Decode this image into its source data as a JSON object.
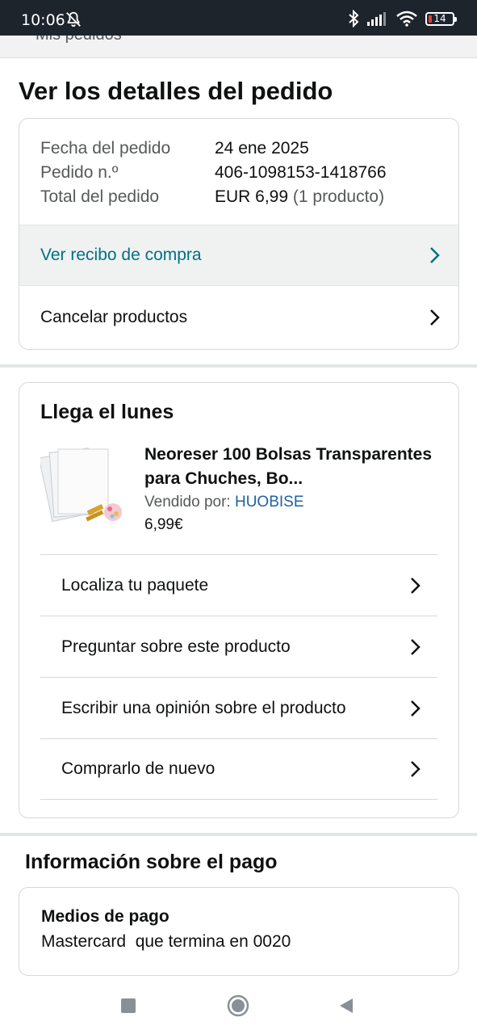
{
  "status_bar": {
    "time": "10:06",
    "battery": "14",
    "icons": [
      "mute-notification-icon",
      "bluetooth-icon",
      "signal-icon",
      "wifi-icon",
      "battery-icon"
    ]
  },
  "top_strip": {
    "text": "Mis pedidos"
  },
  "page": {
    "title": "Ver los detalles del pedido"
  },
  "order": {
    "rows": [
      {
        "label": "Fecha del pedido",
        "value": "24 ene 2025",
        "sub": ""
      },
      {
        "label": "Pedido n.º",
        "value": "406-1098153-1418766",
        "sub": ""
      },
      {
        "label": "Total del pedido",
        "value": "EUR 6,99",
        "sub": " (1 producto)"
      }
    ],
    "receipt_link": "Ver recibo de compra",
    "cancel_link": "Cancelar productos"
  },
  "delivery": {
    "title": "Llega el lunes",
    "product": {
      "title": "Neoreser 100 Bolsas Transparentes para Chuches, Bo...",
      "seller_prefix": "Vendido por: ",
      "seller": "HUOBISE",
      "price": "6,99€"
    },
    "actions": [
      "Localiza tu paquete",
      "Preguntar sobre este producto",
      "Escribir una opinión sobre el producto",
      "Comprarlo de nuevo"
    ]
  },
  "payment": {
    "title": "Información sobre el pago",
    "label": "Medios de pago",
    "value": "Mastercard  que termina en 0020"
  },
  "colors": {
    "status_bar": "#1e242c",
    "link": "#007185",
    "seller_link": "#2162a1",
    "battery_low": "#e0403a"
  }
}
